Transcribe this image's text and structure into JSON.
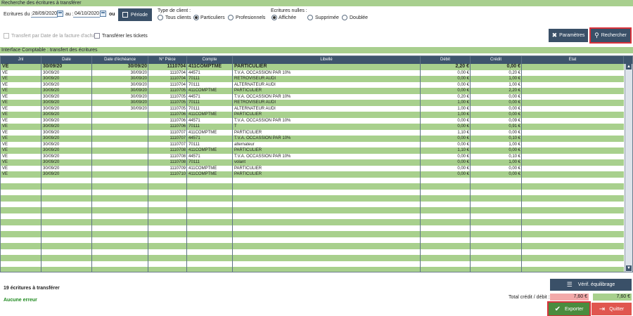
{
  "header": {
    "title": "Recherche des écritures à transférer"
  },
  "filters": {
    "date_from_label": "Ecritures du :",
    "date_from": "28/09/2020",
    "date_to_label": "au :",
    "date_to": "04/10/2020",
    "or_label": "ou",
    "period_button": "Période",
    "client_type_label": "Type de client :",
    "client_types": [
      "Tous clients",
      "Particuliers",
      "Profesionnels"
    ],
    "client_type_selected": "Particuliers",
    "null_entries_label": "Ecritures nulles :",
    "null_entries": [
      "Affichée",
      "Supprimée",
      "Doublée"
    ],
    "null_entries_selected": "Affichée",
    "transfer_by_date_label": "Transfert par Date de la facture d'achat",
    "transfer_tickets_label": "Transférer les tickets",
    "params_button": "Paramètres",
    "search_button": "Rechercher"
  },
  "section": {
    "title": "Interface Comptable : transfert des écritures"
  },
  "table": {
    "columns": [
      "Jnl",
      "Date",
      "Date d'échéance",
      "N° Pièce",
      "Compte",
      "Libellé",
      "Débit",
      "Crédit",
      "Etat"
    ],
    "rows": [
      [
        "VE",
        "30/09/20",
        "30/09/20",
        "1110704",
        "411COMPTME",
        "PARTICULIER",
        "2,20 €",
        "0,00 €",
        ""
      ],
      [
        "VE",
        "30/09/20",
        "30/09/20",
        "1110704",
        "44571",
        "T.V.A. OCCASSION PAR 10%",
        "0,00 €",
        "0,20 €",
        ""
      ],
      [
        "VE",
        "30/09/20",
        "30/09/20",
        "1110704",
        "70111",
        "RETROVISEUR AUDI",
        "0,00 €",
        "1,00 €",
        ""
      ],
      [
        "VE",
        "30/09/20",
        "30/09/20",
        "1110704",
        "70111",
        "ALTERNATEUR AUDI",
        "0,00 €",
        "1,00 €",
        ""
      ],
      [
        "VE",
        "30/09/20",
        "30/09/20",
        "1110705",
        "411COMPTME",
        "PARTICULIER",
        "0,00 €",
        "2,20 €",
        ""
      ],
      [
        "VE",
        "30/09/20",
        "30/09/20",
        "1110705",
        "44571",
        "T.V.A. OCCASSION PAR 10%",
        "0,20 €",
        "0,00 €",
        ""
      ],
      [
        "VE",
        "30/09/20",
        "30/09/20",
        "1110705",
        "70111",
        "RETROVISEUR AUDI",
        "1,00 €",
        "0,00 €",
        ""
      ],
      [
        "VE",
        "30/09/20",
        "30/09/20",
        "1110705",
        "70111",
        "ALTERNATEUR AUDI",
        "1,00 €",
        "0,00 €",
        ""
      ],
      [
        "VE",
        "30/09/20",
        "",
        "1110706",
        "411COMPTME",
        "PARTICULIER",
        "1,00 €",
        "0,00 €",
        ""
      ],
      [
        "VE",
        "30/09/20",
        "",
        "1110706",
        "44571",
        "T.V.A. OCCASSION PAR 10%",
        "0,00 €",
        "0,09 €",
        ""
      ],
      [
        "VE",
        "30/09/20",
        "",
        "1110706",
        "70111",
        "T",
        "0,00 €",
        "0,91 €",
        ""
      ],
      [
        "VE",
        "30/09/20",
        "",
        "1110707",
        "411COMPTME",
        "PARTICULIER",
        "1,10 €",
        "0,00 €",
        ""
      ],
      [
        "VE",
        "30/09/20",
        "",
        "1110707",
        "44571",
        "T.V.A. OCCASSION PAR 10%",
        "0,00 €",
        "0,10 €",
        ""
      ],
      [
        "VE",
        "30/09/20",
        "",
        "1110707",
        "70111",
        "alternateur",
        "0,00 €",
        "1,00 €",
        ""
      ],
      [
        "VE",
        "30/09/20",
        "",
        "1110708",
        "411COMPTME",
        "PARTICULIER",
        "1,10 €",
        "0,00 €",
        ""
      ],
      [
        "VE",
        "30/09/20",
        "",
        "1110708",
        "44571",
        "T.V.A. OCCASSION PAR 10%",
        "0,00 €",
        "0,10 €",
        ""
      ],
      [
        "VE",
        "30/09/20",
        "",
        "1110708",
        "70111",
        "volant",
        "0,00 €",
        "1,00 €",
        ""
      ],
      [
        "VE",
        "30/09/20",
        "",
        "1110709",
        "411COMPTME",
        "PARTICULIER",
        "0,00 €",
        "0,00 €",
        ""
      ],
      [
        "VE",
        "30/09/20",
        "",
        "1110710",
        "411COMPTME",
        "PARTICULIER",
        "0,00 €",
        "0,00 €",
        ""
      ]
    ],
    "empty_rows": 16
  },
  "footer": {
    "count_label": "19 écritures à transférer",
    "error_label": "Aucune erreur",
    "verify_button": "Vérif. équilibrage",
    "total_label": "Total crédit / débit :",
    "total_credit": "7,60 €",
    "total_debit": "7,60 €",
    "export_button": "Exporter",
    "quit_button": "Quitter"
  },
  "colors": {
    "accent": "#3e556d",
    "row_green": "#a8d08d",
    "highlight": "#d9323b",
    "ok_text": "#1f8a1f"
  }
}
